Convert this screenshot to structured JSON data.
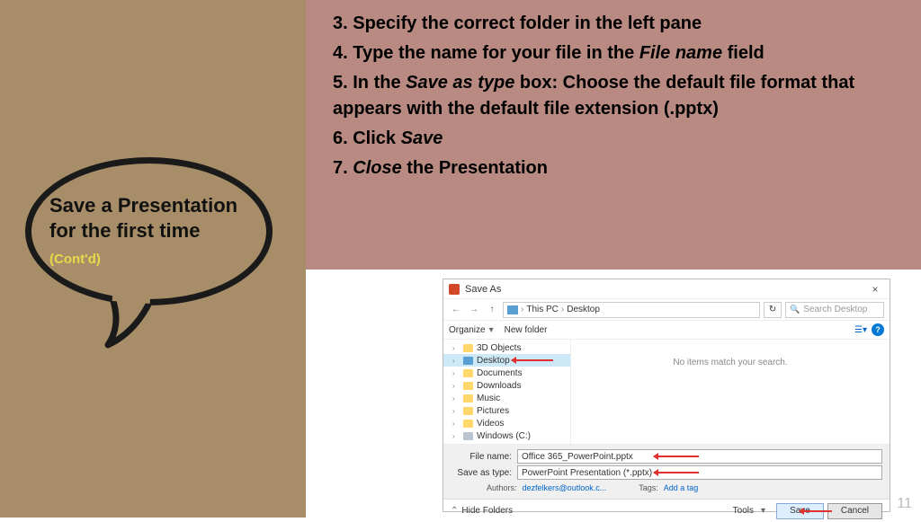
{
  "bubble": {
    "line1": "Save a Presentation",
    "line2": "for the first time",
    "contd": "(Cont'd)"
  },
  "steps": {
    "s3": "3. Specify the correct folder in the left pane",
    "s4a": "4. Type the name for your file in the ",
    "s4b": "File name",
    "s4c": " field",
    "s5a": "5. In the ",
    "s5b": "Save as type",
    "s5c": " box: Choose the default file format that appears with the default file extension (.pptx)",
    "s6a": "6. Click ",
    "s6b": "Save",
    "s7a": "7. ",
    "s7b": "Close",
    "s7c": " the Presentation"
  },
  "dialog": {
    "title": "Save As",
    "close": "×",
    "nav_back": "←",
    "nav_fwd": "→",
    "nav_up": "↑",
    "path_root": "This PC",
    "path_current": "Desktop",
    "search_placeholder": "Search Desktop",
    "refresh": "↻",
    "organize": "Organize",
    "newfolder": "New folder",
    "help": "?",
    "tree": {
      "objects": "3D Objects",
      "desktop": "Desktop",
      "documents": "Documents",
      "downloads": "Downloads",
      "music": "Music",
      "pictures": "Pictures",
      "videos": "Videos",
      "windows_c": "Windows (C:)"
    },
    "empty_msg": "No items match your search.",
    "filename_label": "File name:",
    "filename_value": "Office 365_PowerPoint.pptx",
    "savetype_label": "Save as type:",
    "savetype_value": "PowerPoint Presentation (*.pptx)",
    "authors_label": "Authors:",
    "authors_value": "dezfelkers@outlook.c...",
    "tags_label": "Tags:",
    "tags_value": "Add a tag",
    "hide_folders": "Hide Folders",
    "tools": "Tools",
    "save": "Save",
    "cancel": "Cancel"
  },
  "page_num": "11"
}
